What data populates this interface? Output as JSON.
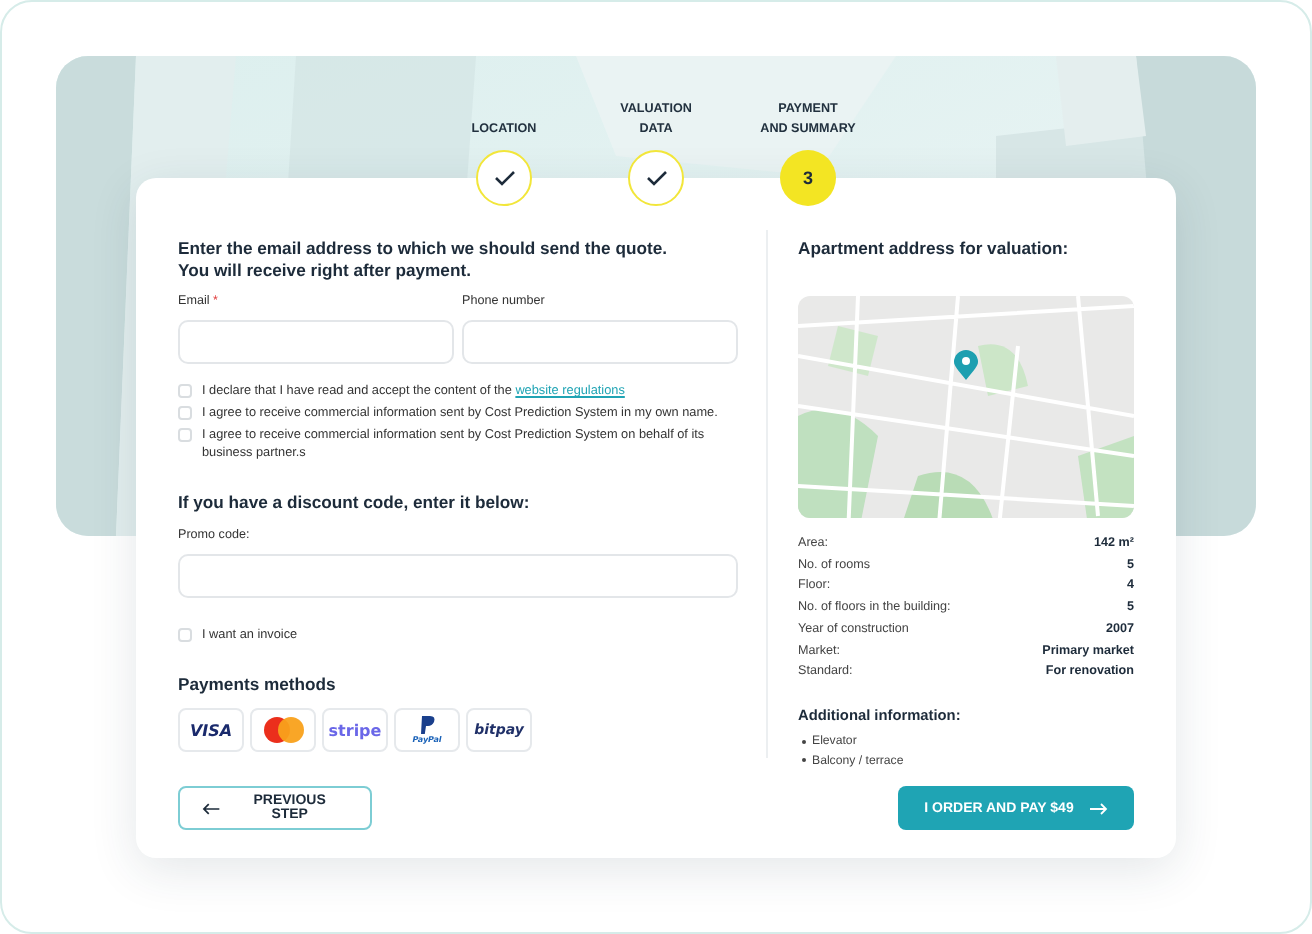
{
  "steps": [
    {
      "label": "LOCATION",
      "kind": "done"
    },
    {
      "label": "VALUATION\nDATA",
      "kind": "done"
    },
    {
      "label": "PAYMENT\nAND SUMMARY",
      "kind": "current",
      "number": "3"
    }
  ],
  "contact": {
    "heading": "Enter the email address to which we should send the quote.\nYou will receive right after payment.",
    "fields": [
      {
        "label": "Email",
        "required_mark": "*"
      },
      {
        "label": "Phone number"
      }
    ],
    "consents": [
      {
        "text": "I declare that I have read and accept the content of the",
        "link": "website regulations",
        "checked": false
      },
      {
        "text": "I agree to receive commercial information sent by Cost Prediction System in my own name.",
        "checked": false
      },
      {
        "text": "I agree to receive commercial information sent by Cost Prediction System on behalf of its business partner.s",
        "checked": false
      }
    ]
  },
  "discount": {
    "heading": "If you have a discount code, enter it below:",
    "label": "Promo code:"
  },
  "invoice": {
    "label": "I want an invoice",
    "checked": false
  },
  "payments": {
    "heading": "Payments methods",
    "methods": [
      {
        "kind": "visa",
        "text": "VISA"
      },
      {
        "kind": "mastercard"
      },
      {
        "kind": "stripe",
        "text": "stripe"
      },
      {
        "kind": "paypal",
        "text": "PayPal"
      },
      {
        "kind": "bitpay",
        "text": "bitpay"
      }
    ]
  },
  "apartment": {
    "heading": "Apartment address for valuation:",
    "map": {
      "kind": "picture"
    },
    "details": [
      {
        "label": "Area:",
        "value": "142 m²"
      },
      {
        "label": "No. of rooms",
        "value": "5"
      },
      {
        "label": "Floor:",
        "value": "4"
      },
      {
        "label": "No. of floors in the building:",
        "value": "5"
      },
      {
        "label": "Year of construction",
        "value": "2007"
      },
      {
        "label": "Market:",
        "value": "Primary market"
      },
      {
        "label": "Standard:",
        "value": "For renovation"
      }
    ],
    "additional_heading": "Additional information:",
    "additional": [
      "Elevator",
      "Balcony / terrace"
    ]
  },
  "buttons": {
    "previous": "PREVIOUS STEP",
    "order": "I ORDER AND PAY $49"
  }
}
